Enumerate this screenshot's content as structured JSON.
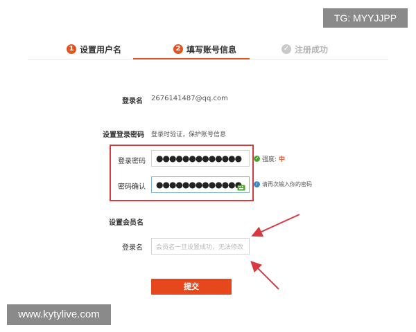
{
  "watermarks": {
    "tg": "TG: MYYJJPP",
    "url": "www.kytylive.com"
  },
  "steps": [
    {
      "num": "1",
      "label": "设置用户名"
    },
    {
      "num": "2",
      "label": "填写账号信息"
    },
    {
      "num": "",
      "label": "注册成功"
    }
  ],
  "login": {
    "label": "登录名",
    "value": "2676141487@qq.com"
  },
  "password_section": {
    "title": "设置登录密码",
    "subtitle": "登录时验证，保护账号信息"
  },
  "password": {
    "label": "登录密码",
    "value": "●●●●●●●●●●●●●",
    "strength_label": "强度:",
    "strength_value": "中"
  },
  "confirm": {
    "label": "密码确认",
    "value": "●●●●●●●●●●●●●",
    "hint": "请再次输入你的密码"
  },
  "member_section": {
    "title": "设置会员名"
  },
  "member": {
    "label": "登录名",
    "placeholder": "会员名一旦设置成功，无法修改"
  },
  "submit": {
    "label": "提交"
  },
  "colors": {
    "accent": "#e5541e",
    "annotation": "#d8383f"
  }
}
